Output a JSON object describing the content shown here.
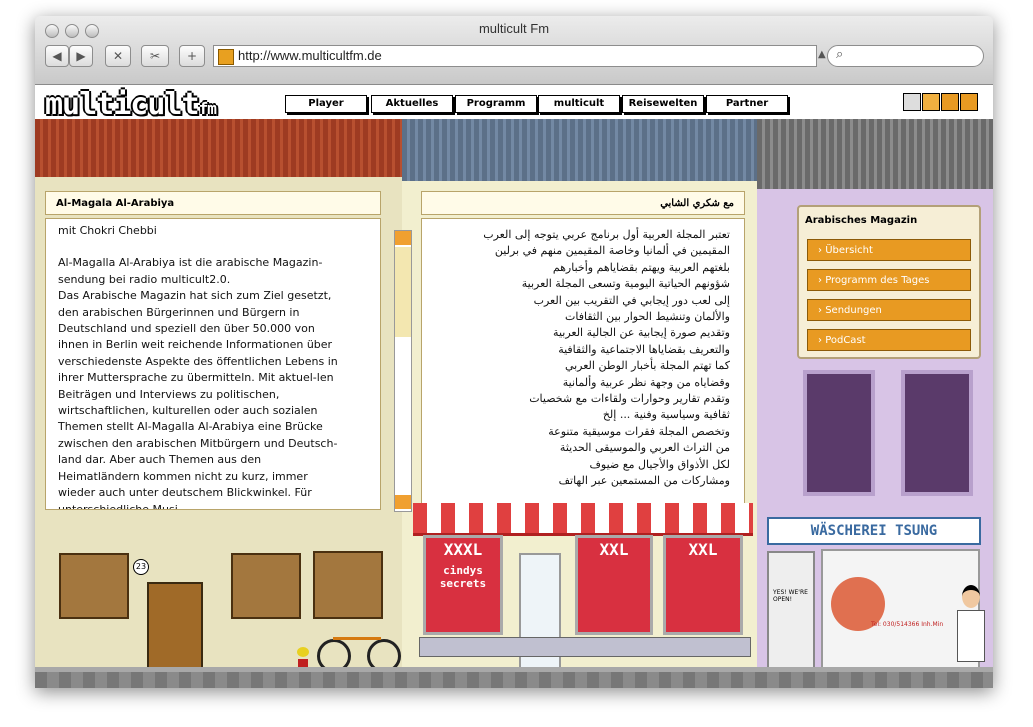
{
  "window": {
    "title": "multicult Fm",
    "url": "http://www.multicultfm.de"
  },
  "logo": {
    "main": "multicult",
    "suffix": "fm"
  },
  "nav": [
    "Player",
    "Aktuelles",
    "Programm",
    "multicult",
    "Reisewelten",
    "Partner"
  ],
  "left_panel": {
    "title": "Al-Magala Al-Arabiya",
    "author": "mit Chokri Chebbi",
    "paragraphs": [
      "Al-Magalla Al-Arabiya ist die arabische Magazin-sendung bei radio multicult2.0.",
      "Das Arabische Magazin hat sich zum Ziel gesetzt, den arabischen Bürgerinnen und Bürgern in Deutschland und speziell den über 50.000 von ihnen in Berlin weit reichende Informationen über verschiedenste Aspekte des öffentlichen Lebens in ihrer Muttersprache zu übermitteln. Mit aktuel-len Beiträgen und Interviews zu politischen, wirtschaftlichen, kulturellen oder auch sozialen Themen stellt Al-Magalla Al-Arabiya eine Brücke zwischen den arabischen Mitbürgern und Deutsch-land dar. Aber auch Themen aus den Heimatländern kommen nicht zu kurz, immer wieder auch unter deutschem Blickwinkel. Für unterschiedliche Musi-"
    ]
  },
  "right_panel": {
    "title": "مع شكري الشابي",
    "lines": [
      "تعتبر المجلة العربية أول برنامج عربي يتوجه إلى العرب",
      "المقيمين في ألمانيا وخاصة المقيمين منهم في برلين",
      "بلغتهم العربية ويهتم بقضاياهم وأخبارهم",
      "شؤونهم الحياتية اليومية وتسعى المجلة العربية",
      "إلى لعب دور إيجابي في التقريب بين العرب",
      "والألمان وتنشيط الحوار بين الثقافات",
      "وتقديم صورة إيجابية عن الجالية العربية",
      "والتعريف بقضاياها الاجتماعية والثقافية",
      "كما تهتم المجلة بأخبار الوطن العربي",
      "وقضاياه من وجهة نظر عربية وألمانية",
      "وتقدم تقارير وحوارات ولقاءات مع شخصيات",
      "ثقافية وسياسية وفنية ... إلخ",
      "وتخصص المجلة فقرات موسيقية متنوعة",
      "من التراث العربي والموسيقى الحديثة",
      "لكل الأذواق والأجيال مع ضيوف",
      "ومشاركات من المستمعين عبر الهاتف"
    ]
  },
  "magazine": {
    "title": "Arabisches Magazin",
    "items": [
      "Übersicht",
      "Programm des Tages",
      "Sendungen",
      "PodCast"
    ]
  },
  "street": {
    "house_number": "23",
    "shop_sign_1": "XXXL",
    "shop_sign_1_sub": "cindys secrets",
    "shop_sign_2": "XXL",
    "shop_sign_3": "XXL",
    "laundry_sign": "WÄSCHEREI TSUNG",
    "laundry_phone": "Tel: 030/514366 Inh.Min",
    "door_sign": "YES! WE'RE OPEN!"
  },
  "colors": {
    "accent": "#e89a22",
    "roof_red": "#9e3b22",
    "roof_blue": "#5c7088",
    "wall_purple": "#d8c4e6"
  }
}
